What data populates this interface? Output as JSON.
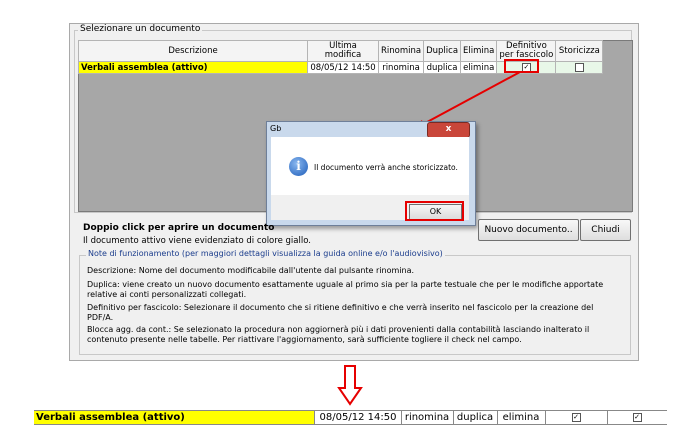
{
  "section": {
    "legend": "Selezionare un documento"
  },
  "table": {
    "headers": [
      "Descrizione",
      "Ultima modifica",
      "Rinomina",
      "Duplica",
      "Elimina",
      "Definitivo per fascicolo",
      "Storicizza"
    ],
    "row": {
      "description": "Verbali assemblea (attivo)",
      "date": "08/05/12 14:50",
      "rinomina": "rinomina",
      "duplica": "duplica",
      "elimina": "elimina",
      "definitivo_checked": true,
      "storicizza_checked": false
    }
  },
  "dialog": {
    "title": "Gb",
    "close": "x",
    "message": "Il documento verrà anche storicizzato.",
    "ok": "OK",
    "icon": "info-icon"
  },
  "lower": {
    "doppio_click": "Doppio click per aprire un documento",
    "doc_attivo": "Il documento attivo viene evidenziato di colore giallo.",
    "btn_nuovo": "Nuovo documento..",
    "btn_chiudi": "Chiudi"
  },
  "notes": {
    "legend": "Note di funzionamento (per maggiori dettagli visualizza la guida online e/o l'audiovisivo)",
    "items": [
      "Descrizione: Nome del documento modificabile dall'utente dal pulsante rinomina.",
      "Duplica: viene creato un nuovo documento esattamente uguale al primo sia per la parte testuale che per le modifiche apportate relative ai conti personalizzati collegati.",
      "Definitivo per fascicolo: Selezionare il documento che si ritiene definitivo e che verrà inserito nel fascicolo per la creazione del PDF/A.",
      "Blocca agg. da cont.: Se selezionato la procedura non aggiornerà più i dati provenienti dalla contabilità lasciando inalterato il contenuto presente nelle tabelle. Per riattivare l'aggiornamento, sarà sufficiente togliere il check nel campo."
    ]
  },
  "strip": {
    "description": "Verbali assemblea (attivo)",
    "date": "08/05/12 14:50",
    "rinomina": "rinomina",
    "duplica": "duplica",
    "elimina": "elimina"
  },
  "colors": {
    "active_row": "#ffff00",
    "highlight": "#e60000",
    "arrow": "#e60000"
  }
}
